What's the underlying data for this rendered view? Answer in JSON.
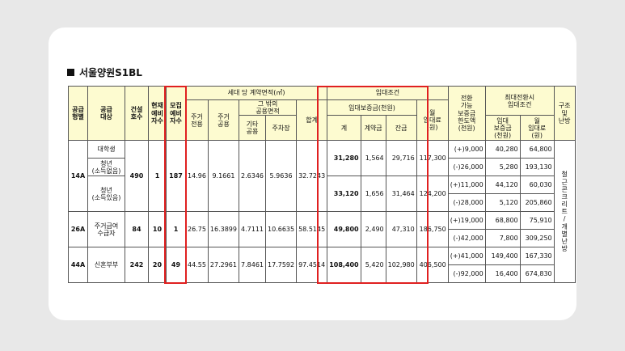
{
  "title": "서울양원S1BL",
  "headers": {
    "supply_type": "공급\n형별",
    "supply_target": "공급\n대상",
    "build_units": "건설\n호수",
    "current_reserve": "현재\n예비\n자수",
    "recruit_reserve": "모집\n예비\n자수",
    "area_group": "세대 당 계약면적(㎡)",
    "residential_exclusive": "주거\n전용",
    "residential_common": "주거\n공용",
    "other_common_group": "그 밖의\n공용면적",
    "other_common": "기타\n공용",
    "parking": "주차장",
    "total": "합계",
    "lease_group": "임대조건",
    "deposit_group": "임대보증금(천원)",
    "sum": "계",
    "down_payment": "계약금",
    "balance": "잔금",
    "monthly_rent": "월\n임대료\n(원)",
    "conversion_limit": "전환\n가능\n보증금\n한도액\n(천원)",
    "max_conversion_group": "최대전환시\n임대조건",
    "conv_deposit": "임대\n보증금\n(천원)",
    "conv_rent": "월\n임대료\n(원)",
    "structure": "구조\n및\n난방"
  },
  "structure_text": "철근콘크리트/개별난방",
  "groups": [
    {
      "type": "14A",
      "units": "490",
      "current_reserve": "1",
      "recruit_reserve": "187",
      "residential_exclusive": "14.96",
      "residential_common": "9.1661",
      "other_common": "2.6346",
      "parking": "5.9636",
      "total": "32.7243",
      "targets": [
        {
          "label": "대학생",
          "deposit_total": "31,280",
          "down_payment": "1,564",
          "balance": "29,716",
          "monthly_rent": "117,300",
          "conversions": [
            {
              "limit": "(+)9,000",
              "deposit": "40,280",
              "rent": "64,800"
            }
          ]
        },
        {
          "label": "청년\n(소득없음)",
          "conversions": [
            {
              "limit": "(-)26,000",
              "deposit": "5,280",
              "rent": "193,130"
            }
          ]
        },
        {
          "label": "청년\n(소득있음)",
          "deposit_total": "33,120",
          "down_payment": "1,656",
          "balance": "31,464",
          "monthly_rent": "124,200",
          "conversions": [
            {
              "limit": "(+)11,000",
              "deposit": "44,120",
              "rent": "60,030"
            },
            {
              "limit": "(-)28,000",
              "deposit": "5,120",
              "rent": "205,860"
            }
          ]
        }
      ]
    },
    {
      "type": "26A",
      "units": "84",
      "current_reserve": "10",
      "recruit_reserve": "1",
      "residential_exclusive": "26.75",
      "residential_common": "16.3899",
      "other_common": "4.7111",
      "parking": "10.6635",
      "total": "58.5145",
      "targets": [
        {
          "label": "주거급여\n수급자",
          "deposit_total": "49,800",
          "down_payment": "2,490",
          "balance": "47,310",
          "monthly_rent": "186,750",
          "conversions": [
            {
              "limit": "(+)19,000",
              "deposit": "68,800",
              "rent": "75,910"
            },
            {
              "limit": "(-)42,000",
              "deposit": "7,800",
              "rent": "309,250"
            }
          ]
        }
      ]
    },
    {
      "type": "44A",
      "units": "242",
      "current_reserve": "20",
      "recruit_reserve": "49",
      "residential_exclusive": "44.55",
      "residential_common": "27.2961",
      "other_common": "7.8461",
      "parking": "17.7592",
      "total": "97.4514",
      "targets": [
        {
          "label": "신혼부부",
          "deposit_total": "108,400",
          "down_payment": "5,420",
          "balance": "102,980",
          "monthly_rent": "406,500",
          "conversions": [
            {
              "limit": "(+)41,000",
              "deposit": "149,400",
              "rent": "167,330"
            },
            {
              "limit": "(-)92,000",
              "deposit": "16,400",
              "rent": "674,830"
            }
          ]
        }
      ]
    }
  ],
  "highlight_color": "#e02020"
}
